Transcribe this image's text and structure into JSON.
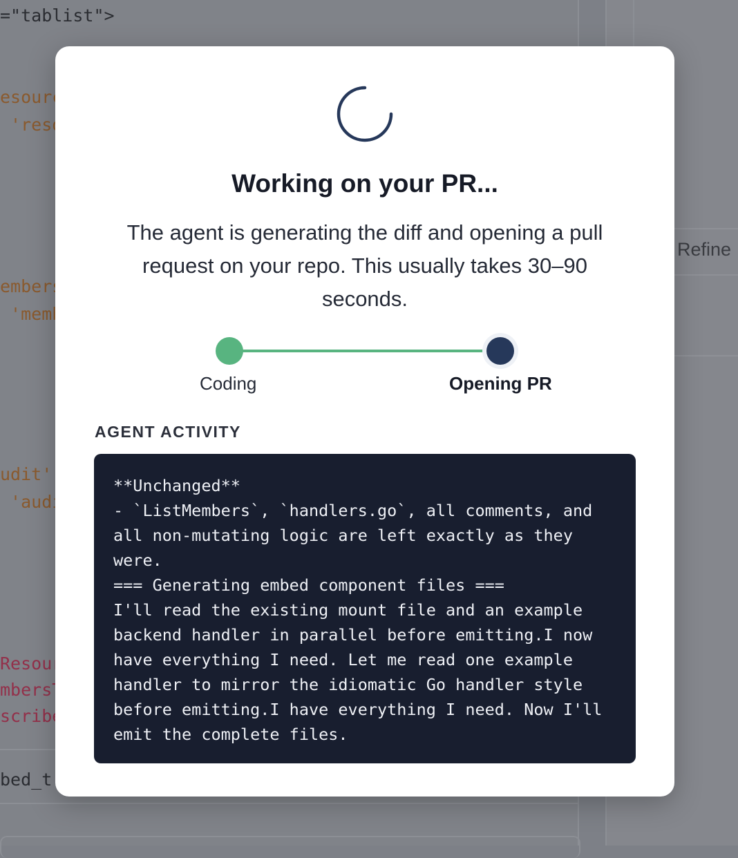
{
  "background": {
    "code_lines": [
      {
        "text": "=\"tablist\">",
        "tone": "plain"
      },
      {
        "text": "esourc",
        "tone": "str"
      },
      {
        "text": " 'reso",
        "tone": "str"
      },
      {
        "text": "embers",
        "tone": "str"
      },
      {
        "text": " 'memb",
        "tone": "str"
      },
      {
        "text": "udit'",
        "tone": "str"
      },
      {
        "text": " 'audi",
        "tone": "str"
      },
      {
        "text": "Resour",
        "tone": "kw"
      },
      {
        "text": "mbersT",
        "tone": "kw"
      },
      {
        "text": "scribe",
        "tone": "kw"
      },
      {
        "text": "bed_t",
        "tone": "plain"
      }
    ],
    "right_panel_label": "Refine"
  },
  "modal": {
    "title": "Working on your PR...",
    "description": "The agent is generating the diff and opening a pull request on your repo. This usually takes 30–90 seconds.",
    "steps": [
      {
        "label": "Coding",
        "state": "done"
      },
      {
        "label": "Opening PR",
        "state": "active"
      }
    ],
    "activity_heading": "AGENT ACTIVITY",
    "activity_lines": [
      "**Unchanged**",
      "- `ListMembers`, `handlers.go`, all comments, and",
      "all non-mutating logic are left exactly as they",
      "were.",
      "=== Generating embed component files ===",
      "I'll read the existing mount file and an example",
      "backend handler in parallel before emitting.I now",
      "have everything I need. Let me read one example",
      "handler to mirror the idiomatic Go handler style",
      "before emitting.I have everything I need. Now I'll",
      "emit the complete files."
    ]
  },
  "colors": {
    "overlay": "#7d8087",
    "spinner": "#26385a",
    "step_done": "#58b480",
    "step_active": "#26385a",
    "activity_bg": "#181e2f"
  }
}
